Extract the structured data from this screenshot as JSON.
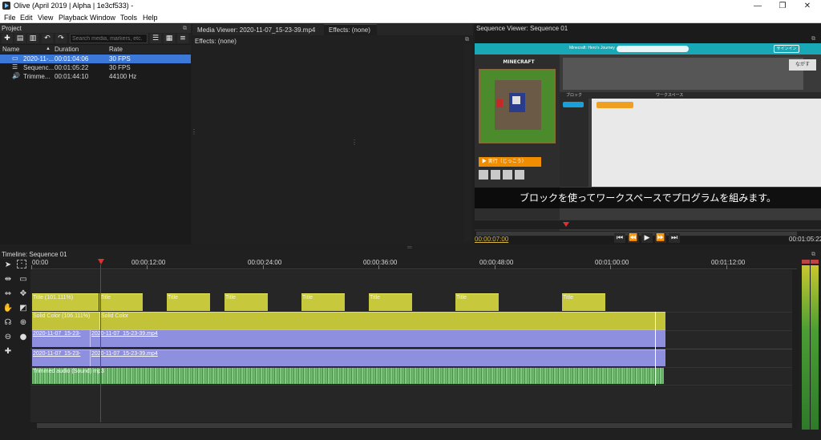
{
  "window": {
    "title": "Olive (April 2019 | Alpha | 1e3cf533) -",
    "controls": {
      "minimize": "—",
      "maximize": "❐",
      "close": "✕"
    }
  },
  "menu": [
    "File",
    "Edit",
    "View",
    "Playback",
    "Window",
    "Tools",
    "Help"
  ],
  "project": {
    "title": "Project",
    "search_placeholder": "Search media, markers, etc.",
    "columns": {
      "name": "Name",
      "duration": "Duration",
      "rate": "Rate"
    },
    "rows": [
      {
        "name": "2020-11-...",
        "duration": "00:01:04:06",
        "rate": "30 FPS",
        "icon": "video-icon",
        "selected": true
      },
      {
        "name": "Sequenc...",
        "duration": "00:01:05:22",
        "rate": "30 FPS",
        "icon": "sequence-icon",
        "selected": false
      },
      {
        "name": "Trimme...",
        "duration": "00:01:44:10",
        "rate": "44100 Hz",
        "icon": "audio-icon",
        "selected": false
      }
    ]
  },
  "media_viewer": {
    "tab": "Media Viewer: 2020-11-07_15-23-39.mp4",
    "effects_tab": "Effects: (none)",
    "effects_label": "Effects: (none)"
  },
  "sequence_viewer": {
    "title": "Sequence Viewer: Sequence 01",
    "current_time": "00:00:07:00",
    "end_time": "00:01:05:22",
    "video": {
      "banner": "Minecraft: Hero's Journey",
      "subtitle": "ブロックを使ってワークスペースでプログラムを組みます。",
      "run_button": "▶ 実行（じっこう）",
      "block_tab": "ブロック",
      "workspace_tab": "ワークスペース",
      "signin": "サインイン",
      "cancel": "ながす",
      "minecraft_logo": "MINECRAFT"
    }
  },
  "timeline": {
    "title": "Timeline: Sequence 01",
    "ruler": [
      "00:00",
      "00:00:12:00",
      "00:00:24:00",
      "00:00:36:00",
      "00:00:48:00",
      "00:01:00:00",
      "00:01:12:00"
    ],
    "tracks": {
      "titles": [
        "Title (101.111%)",
        "Title",
        "Title",
        "Title",
        "Title",
        "Title",
        "Title",
        "Title"
      ],
      "solid": [
        "Solid Color (106.111%)",
        "Solid Color"
      ],
      "video1": [
        "2020-11-07_15-23-",
        "2020-11-07_15-23-39.mp4"
      ],
      "video2": [
        "2020-11-07_15-23-",
        "2020-11-07_15-23-39.mp4"
      ],
      "audio": [
        "Trimmed audio (Sound) mp3"
      ]
    }
  }
}
